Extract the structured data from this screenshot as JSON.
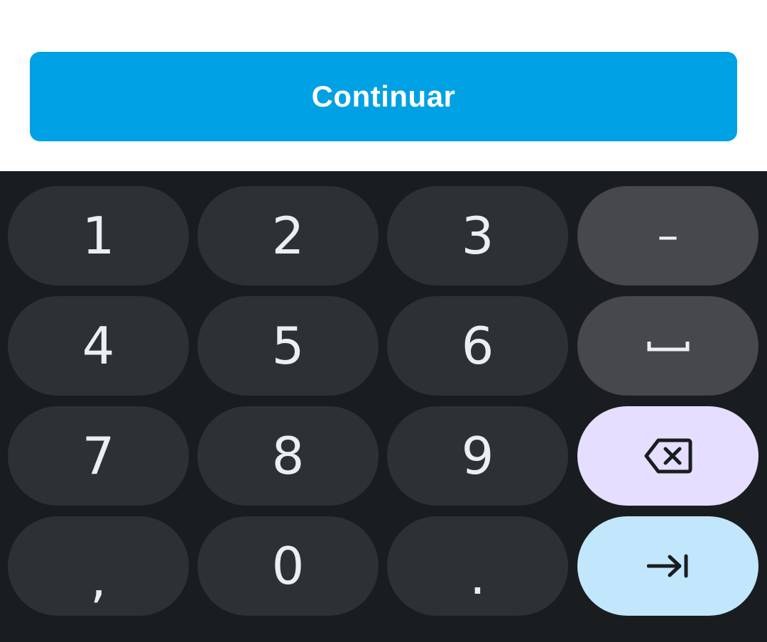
{
  "form": {
    "continue_label": "Continuar",
    "continue_color": "#00a1e4"
  },
  "keyboard": {
    "rows": [
      [
        {
          "label": "1",
          "name": "key-1"
        },
        {
          "label": "2",
          "name": "key-2"
        },
        {
          "label": "3",
          "name": "key-3"
        },
        {
          "label": "–",
          "name": "key-minus"
        }
      ],
      [
        {
          "label": "4",
          "name": "key-4"
        },
        {
          "label": "5",
          "name": "key-5"
        },
        {
          "label": "6",
          "name": "key-6"
        },
        {
          "icon": "space-icon",
          "name": "key-space"
        }
      ],
      [
        {
          "label": "7",
          "name": "key-7"
        },
        {
          "label": "8",
          "name": "key-8"
        },
        {
          "label": "9",
          "name": "key-9"
        },
        {
          "icon": "backspace-icon",
          "name": "key-backspace"
        }
      ],
      [
        {
          "label": ",",
          "name": "key-comma"
        },
        {
          "label": "0",
          "name": "key-0"
        },
        {
          "label": ".",
          "name": "key-period"
        },
        {
          "icon": "next-field-icon",
          "name": "key-next"
        }
      ]
    ],
    "colors": {
      "background": "#1a1d20",
      "key": "#2d3135",
      "function_key": "#46484b",
      "backspace_key": "#e5defe",
      "next_key": "#c2e7fd"
    }
  }
}
